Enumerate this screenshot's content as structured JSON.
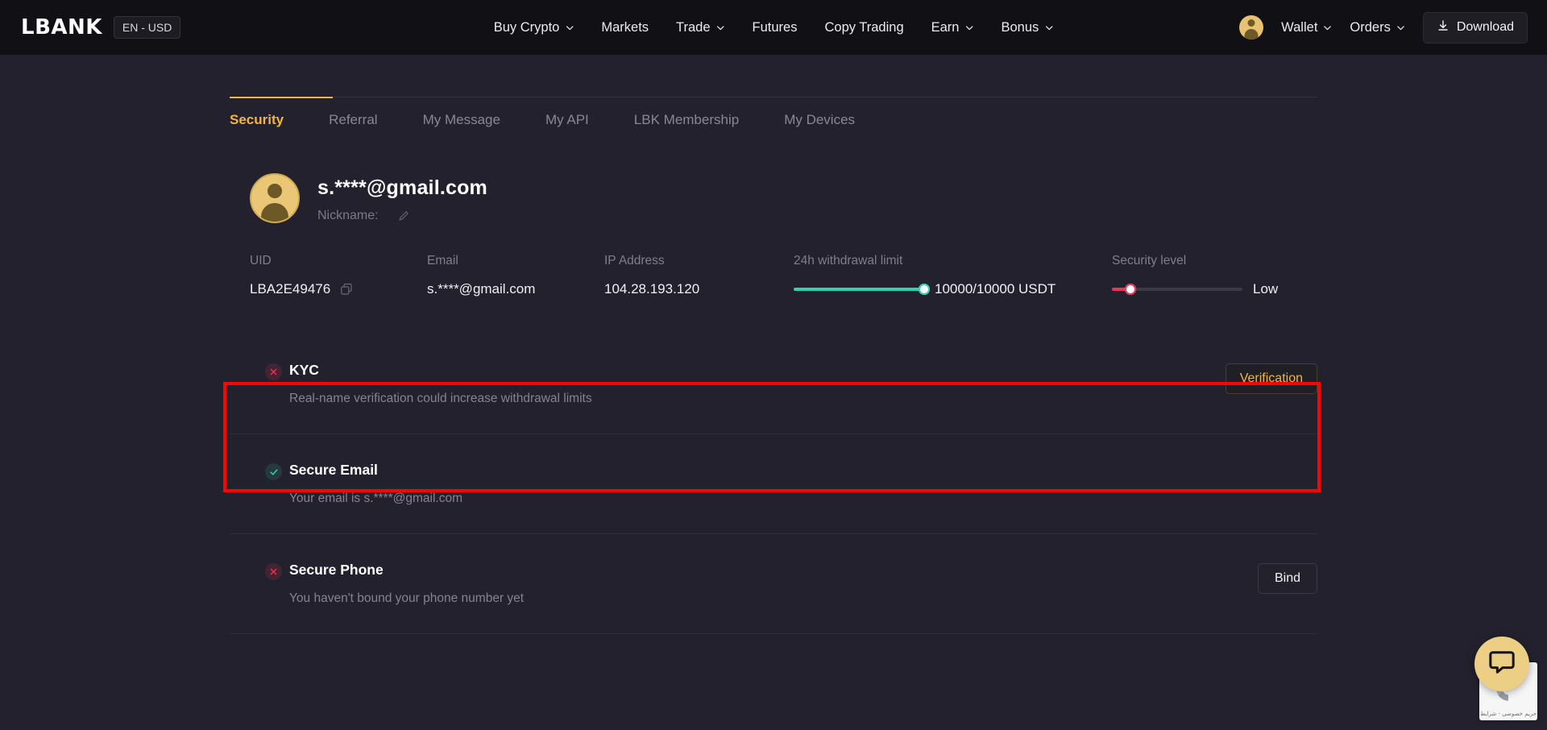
{
  "header": {
    "logo": "LBANK",
    "lang_currency": "EN - USD",
    "nav": [
      {
        "label": "Buy Crypto",
        "has_caret": true
      },
      {
        "label": "Markets",
        "has_caret": false
      },
      {
        "label": "Trade",
        "has_caret": true
      },
      {
        "label": "Futures",
        "has_caret": false
      },
      {
        "label": "Copy Trading",
        "has_caret": false
      },
      {
        "label": "Earn",
        "has_caret": true
      },
      {
        "label": "Bonus",
        "has_caret": true
      }
    ],
    "wallet_label": "Wallet",
    "orders_label": "Orders",
    "download_label": "Download"
  },
  "tabs": [
    {
      "label": "Security",
      "active": true
    },
    {
      "label": "Referral",
      "active": false
    },
    {
      "label": "My Message",
      "active": false
    },
    {
      "label": "My API",
      "active": false
    },
    {
      "label": "LBK Membership",
      "active": false
    },
    {
      "label": "My Devices",
      "active": false
    }
  ],
  "profile": {
    "email_title": "s.****@gmail.com",
    "nickname_label": "Nickname:",
    "nickname_value": ""
  },
  "info": {
    "uid": {
      "label": "UID",
      "value": "LBA2E49476"
    },
    "email": {
      "label": "Email",
      "value": "s.****@gmail.com"
    },
    "ip": {
      "label": "IP Address",
      "value": "104.28.193.120"
    },
    "withdrawal": {
      "label": "24h withdrawal limit",
      "value": "10000/10000 USDT",
      "percent": 100
    },
    "security_level": {
      "label": "Security level",
      "value": "Low",
      "percent": 14
    }
  },
  "security_items": [
    {
      "key": "kyc",
      "title": "KYC",
      "description": "Real-name verification could increase withdrawal limits",
      "status": "bad",
      "action_label": "Verification",
      "action_style": "gold"
    },
    {
      "key": "secure-email",
      "title": "Secure Email",
      "description": "Your email is s.****@gmail.com",
      "status": "good",
      "action_label": "",
      "action_style": "none"
    },
    {
      "key": "secure-phone",
      "title": "Secure Phone",
      "description": "You haven't bound your phone number yet",
      "status": "bad",
      "action_label": "Bind",
      "action_style": "plain"
    }
  ],
  "widgets": {
    "recaptcha_terms": "حریم خصوصی - شرایط"
  },
  "colors": {
    "accent_gold": "#f5b441",
    "danger_red": "#e8365a",
    "success_teal": "#2fd3ae",
    "annotation_red": "#fb0404",
    "page_bg": "#23212d",
    "header_bg": "#111115"
  }
}
